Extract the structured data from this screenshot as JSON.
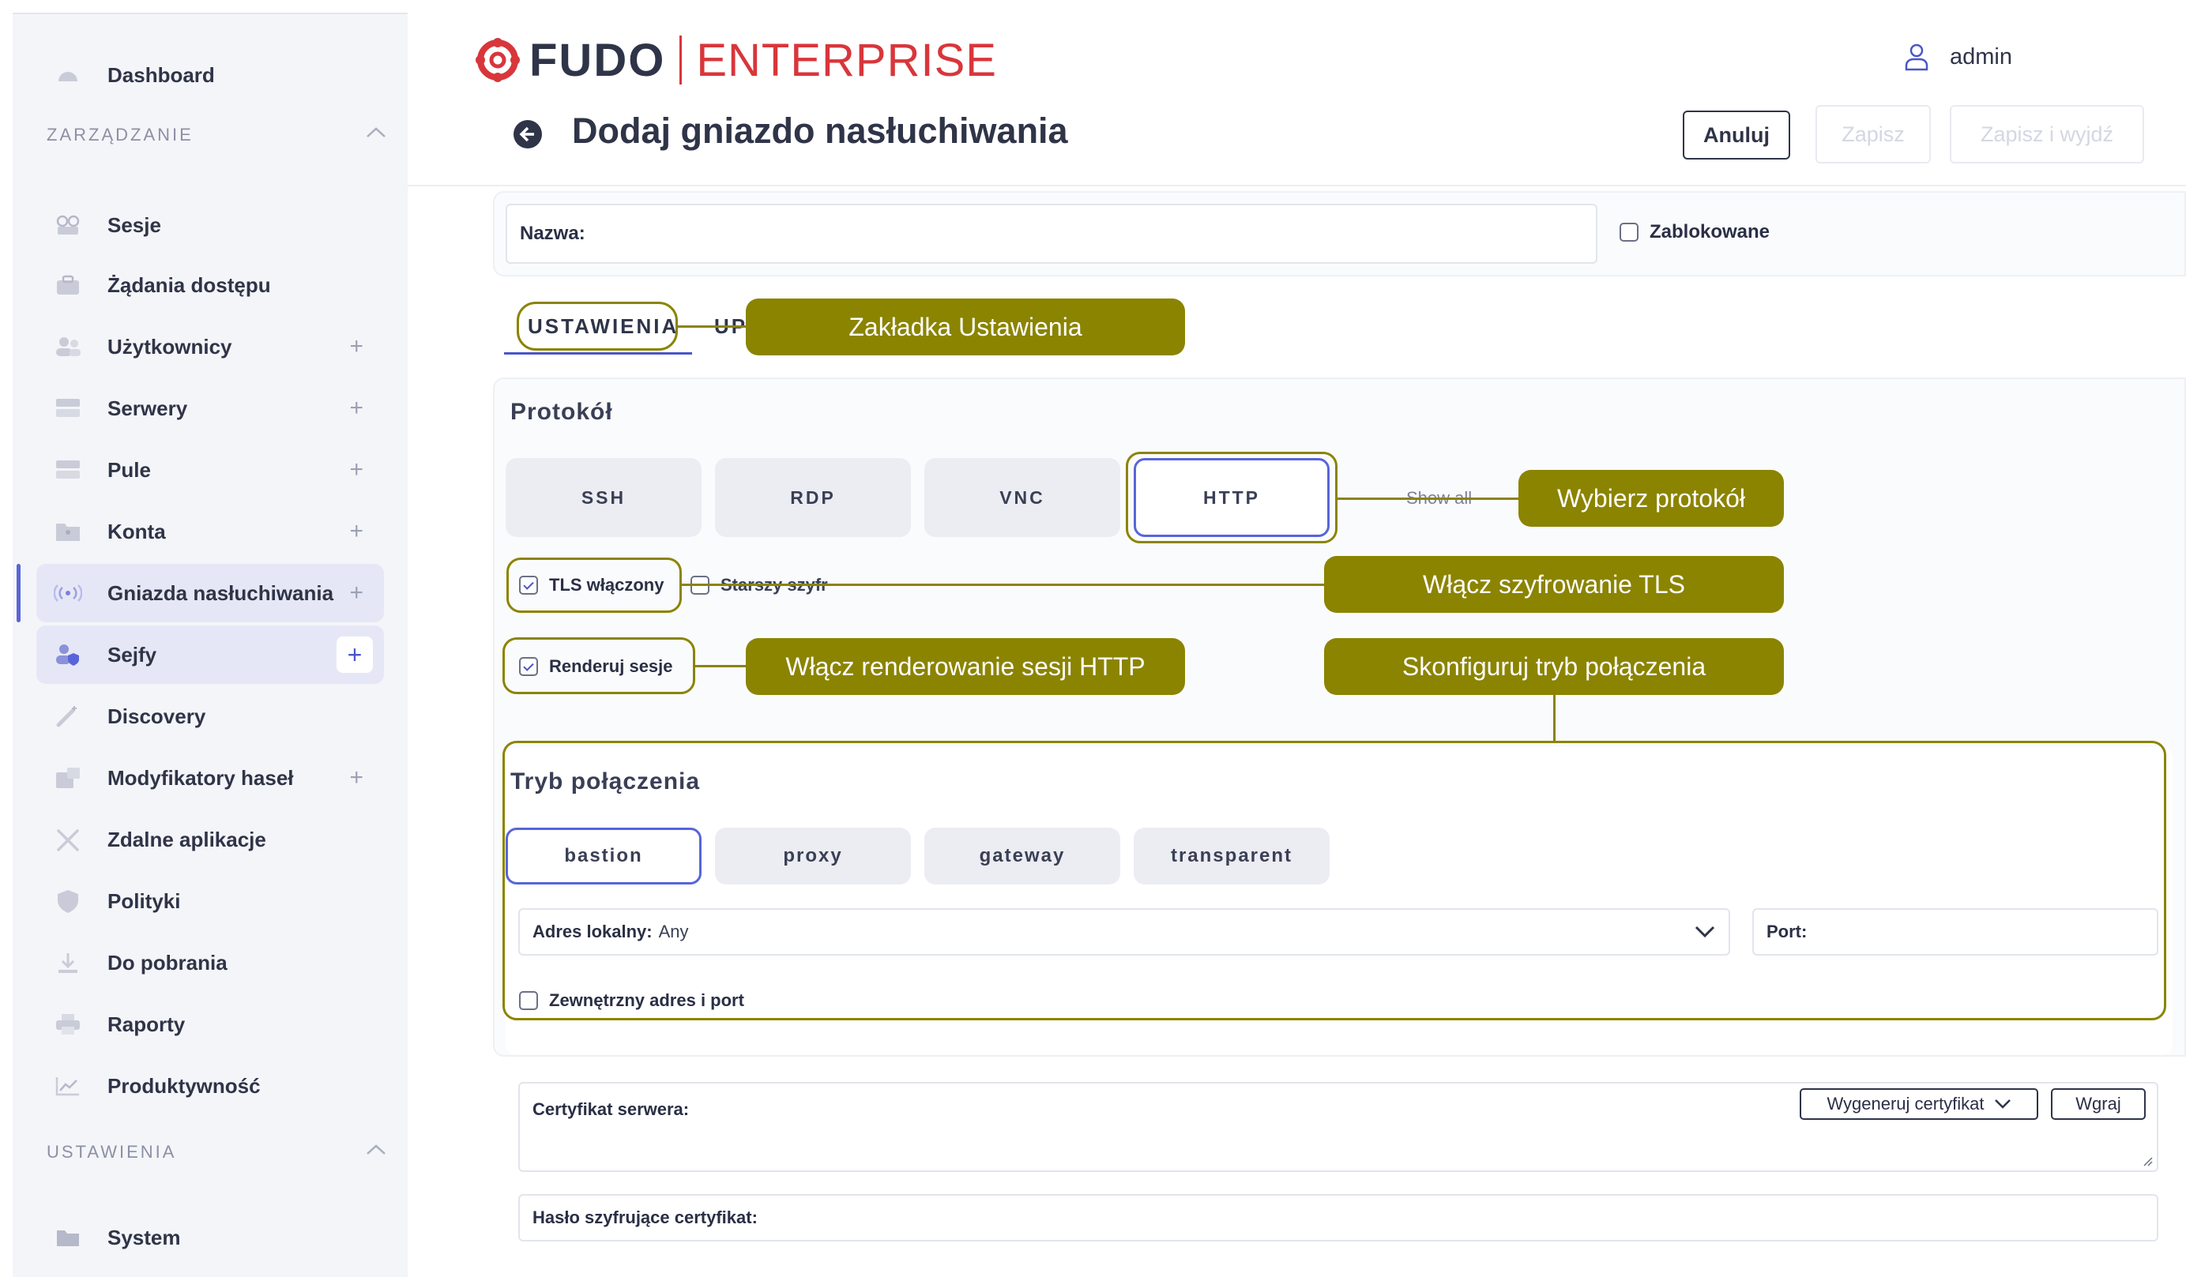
{
  "sidebar": {
    "dashboard": "Dashboard",
    "section_management": "ZARZĄDZANIE",
    "items": [
      {
        "label": "Sesje"
      },
      {
        "label": "Żądania dostępu"
      },
      {
        "label": "Użytkownicy"
      },
      {
        "label": "Serwery"
      },
      {
        "label": "Pule"
      },
      {
        "label": "Konta"
      },
      {
        "label": "Gniazda nasłuchiwania"
      },
      {
        "label": "Sejfy"
      },
      {
        "label": "Discovery"
      },
      {
        "label": "Modyfikatory haseł"
      },
      {
        "label": "Zdalne aplikacje"
      },
      {
        "label": "Polityki"
      },
      {
        "label": "Do pobrania"
      },
      {
        "label": "Raporty"
      },
      {
        "label": "Produktywność"
      }
    ],
    "section_settings": "USTAWIENIA",
    "system": "System",
    "plus": "+"
  },
  "header": {
    "logo_fudo": "FUDO",
    "logo_enterprise": "ENTERPRISE",
    "username": "admin",
    "title": "Dodaj gniazdo nasłuchiwania",
    "cancel": "Anuluj",
    "save": "Zapisz",
    "save_exit": "Zapisz i wyjdź"
  },
  "form": {
    "name_label": "Nazwa:",
    "blocked_label": "Zablokowane",
    "tab_settings": "USTAWIENIA",
    "tab_second_partial": "UP",
    "protocol_title": "Protokół",
    "protocols": [
      "SSH",
      "RDP",
      "VNC",
      "HTTP"
    ],
    "selected_protocol": "HTTP",
    "show_all": "Show all",
    "tls_label": "TLS włączony",
    "tls_checked": true,
    "legacy_cipher_label": "Starszy szyfr",
    "render_label": "Renderuj sesje",
    "render_checked": true,
    "mode_title": "Tryb połączenia",
    "modes": [
      "bastion",
      "proxy",
      "gateway",
      "transparent"
    ],
    "selected_mode": "bastion",
    "local_address_label": "Adres lokalny:",
    "local_address_value": "Any",
    "port_label": "Port:",
    "external_label": "Zewnętrzny adres i port",
    "cert_label": "Certyfikat serwera:",
    "generate_cert": "Wygeneruj certyfikat",
    "upload": "Wgraj",
    "cert_password_label": "Hasło szyfrujące certyfikat:"
  },
  "annotations": {
    "tab": "Zakładka Ustawienia",
    "protocol": "Wybierz protokół",
    "tls": "Włącz szyfrowanie TLS",
    "render": "Włącz renderowanie sesji HTTP",
    "mode": "Skonfiguruj tryb połączenia",
    "color": "#8b8400"
  },
  "colors": {
    "accent": "#5865d9",
    "brand_red": "#d8363b",
    "text": "#2f3448"
  }
}
